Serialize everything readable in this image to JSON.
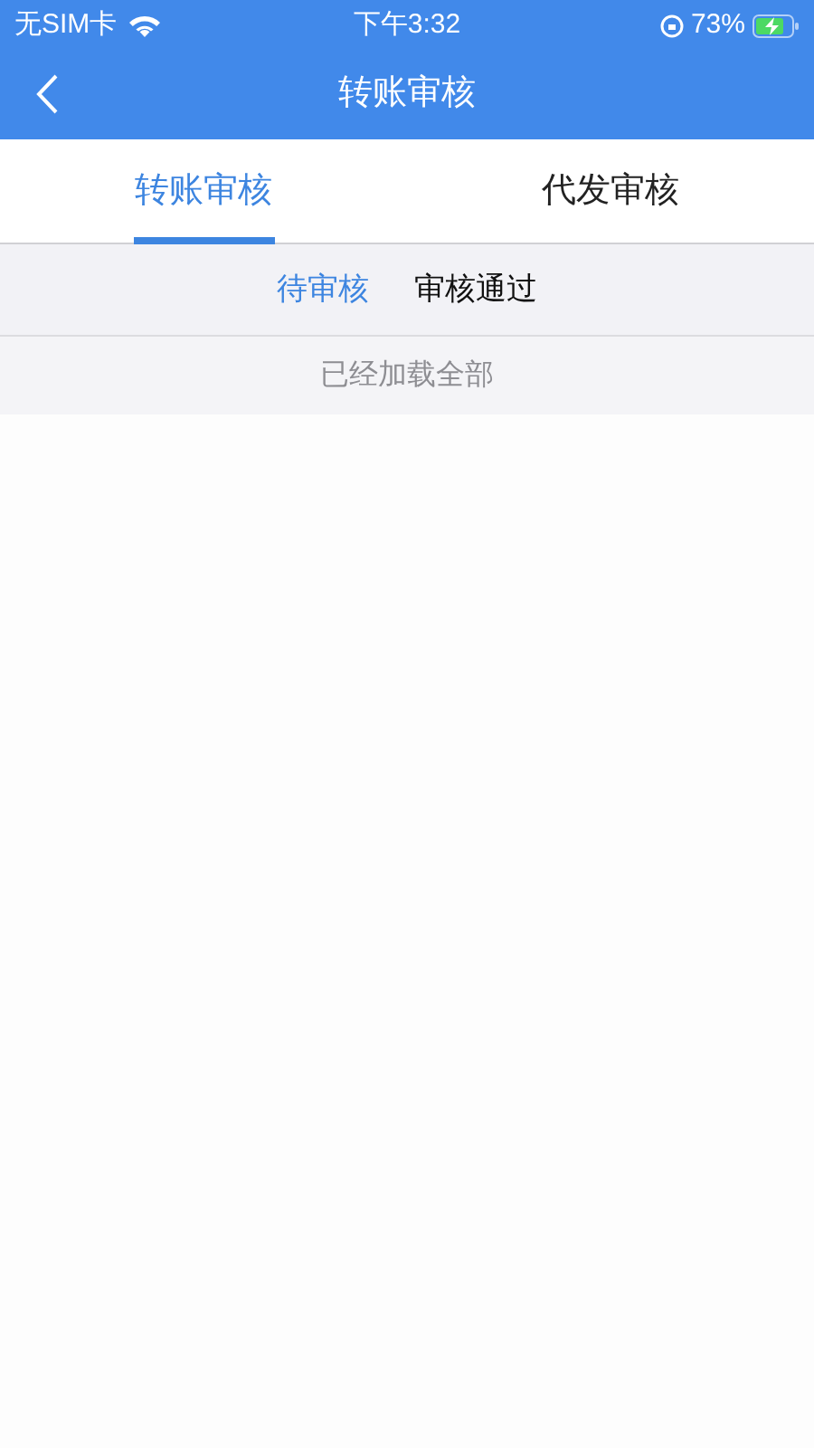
{
  "status_bar": {
    "carrier": "无SIM卡",
    "time": "下午3:32",
    "battery": "73%"
  },
  "nav": {
    "title": "转账审核"
  },
  "tabs": [
    {
      "label": "转账审核",
      "selected": true
    },
    {
      "label": "代发审核",
      "selected": false
    }
  ],
  "sub_tabs": [
    {
      "label": "待审核",
      "selected": true
    },
    {
      "label": "审核通过",
      "selected": false
    }
  ],
  "list_footer": "已经加载全部"
}
